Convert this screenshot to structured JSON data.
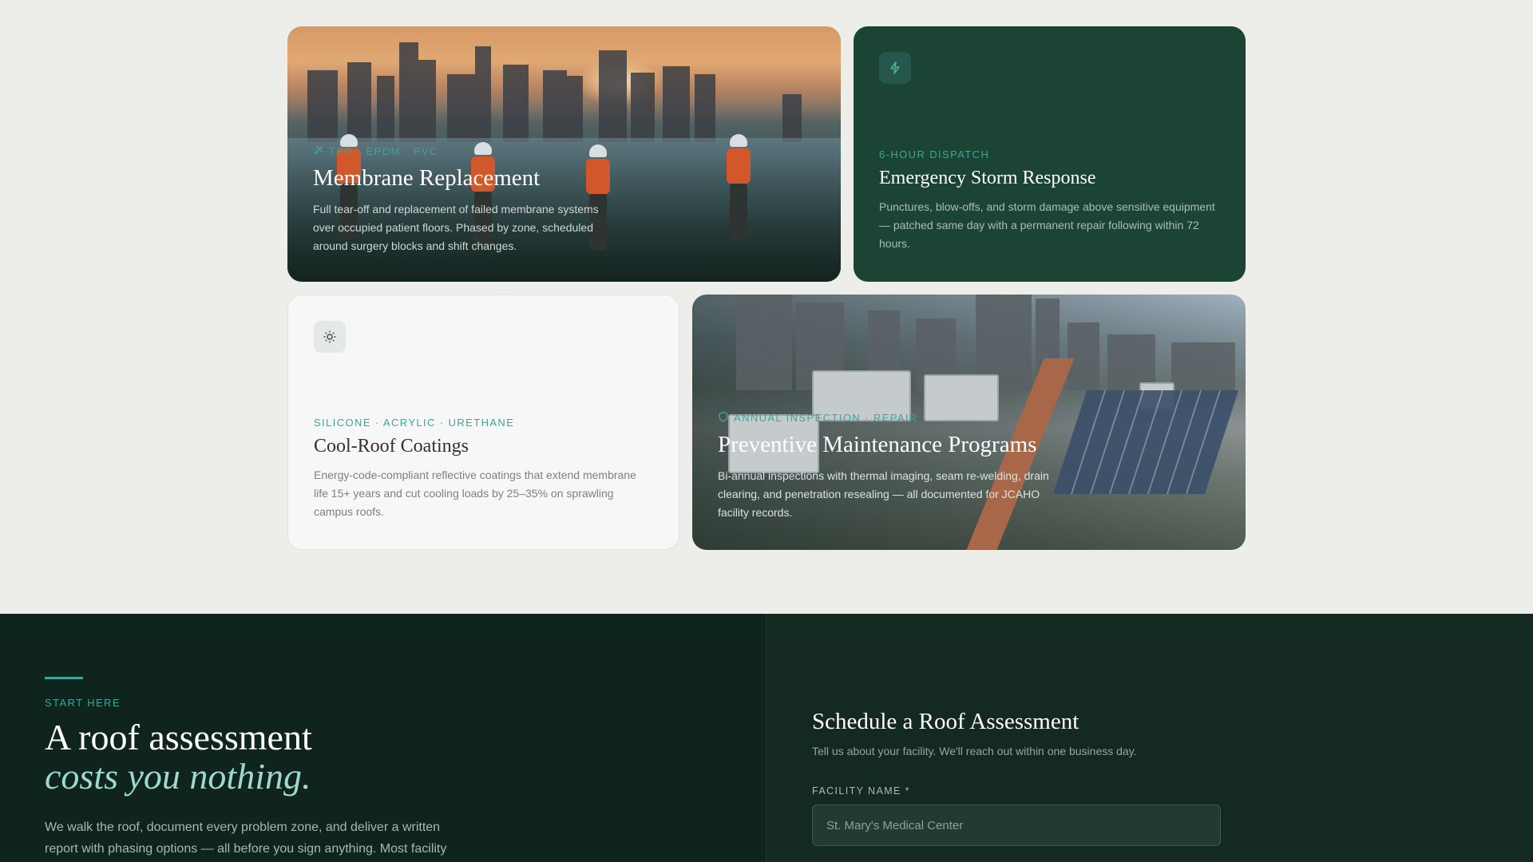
{
  "cards": {
    "membrane": {
      "eyebrow": "TPO · EPDM · PVC",
      "title": "Membrane Replacement",
      "description": "Full tear-off and replacement of failed membrane systems over occupied patient floors. Phased by zone, scheduled around surgery blocks and shift changes.",
      "icon": "tools-icon"
    },
    "storm": {
      "eyebrow": "6-HOUR DISPATCH",
      "title": "Emergency Storm Response",
      "description": "Punctures, blow-offs, and storm damage above sensitive equipment — patched same day with a permanent repair following within 72 hours.",
      "icon": "lightning-icon"
    },
    "coatings": {
      "eyebrow": "SILICONE · ACRYLIC · URETHANE",
      "title": "Cool-Roof Coatings",
      "description": "Energy-code-compliant reflective coatings that extend membrane life 15+ years and cut cooling loads by 25–35% on sprawling campus roofs.",
      "icon": "sun-icon"
    },
    "maintenance": {
      "eyebrow": "ANNUAL INSPECTION · REPAIR",
      "title": "Preventive Maintenance Programs",
      "description": "Bi-annual inspections with thermal imaging, seam re-welding, drain clearing, and penetration resealing — all documented for JCAHO facility records.",
      "icon": "shield-icon"
    }
  },
  "cta": {
    "label": "START HERE",
    "title_line1": "A roof assessment",
    "title_line2": "costs you nothing.",
    "body": "We walk the roof, document every problem zone, and deliver a written report with phasing options — all before you sign anything. Most facility"
  },
  "form": {
    "title": "Schedule a Roof Assessment",
    "subtitle": "Tell us about your facility. We'll reach out within one business day.",
    "facility_label": "FACILITY NAME *",
    "facility_placeholder": "St. Mary's Medical Center"
  },
  "colors": {
    "accent": "#3aa79a",
    "dark_green": "#1c4434",
    "section_dark": "#0f241c",
    "page_bg": "#edeee9"
  }
}
